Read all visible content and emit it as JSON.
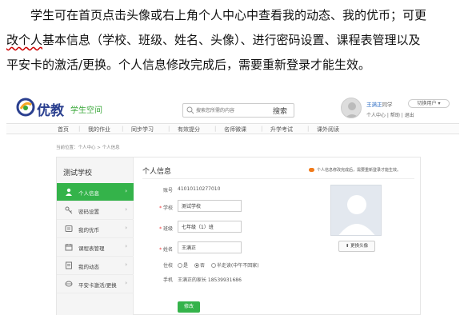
{
  "intro": {
    "line1": "学生可在首页点击头像或右上角个人中心中查看我的动态、我的优币；可更",
    "line2_start": "改个人",
    "line2_rest": "基本信息（学校、班级、姓名、头像）、进行密码设置、课程表管理以及",
    "line3": "平安卡的激活/更换。个人信息修改完成后，需要重新登录才能生效。"
  },
  "header": {
    "logo_text": "优教",
    "logo_sub": "学生空间",
    "search_placeholder": "搜索您所需的内容",
    "search_button": "搜索",
    "user_name": "王满正",
    "user_role": "同学",
    "switch_label": "切换用户",
    "links": "个人中心 | 帮助 | 退出"
  },
  "nav": {
    "items": [
      "首页",
      "我的作业",
      "同步学习",
      "有效提分",
      "名师微课",
      "升学考试",
      "课外阅读"
    ]
  },
  "breadcrumb": "当前位置：个人中心 > 个人信息",
  "sidebar": {
    "school": "测试学校",
    "items": [
      {
        "label": "个人信息",
        "icon": "user-icon"
      },
      {
        "label": "密码设置",
        "icon": "key-icon"
      },
      {
        "label": "我的优币",
        "icon": "coin-icon"
      },
      {
        "label": "课程表管理",
        "icon": "calendar-icon"
      },
      {
        "label": "我的动态",
        "icon": "activity-icon"
      },
      {
        "label": "平安卡激活/更换",
        "icon": "card-icon"
      }
    ]
  },
  "form": {
    "title": "个人信息",
    "hint": "个人信息修改完成后，需要重新登录才能生效。",
    "account_label": "账号",
    "account_value": "41010110277010",
    "school_label": "学校",
    "school_value": "测试学校",
    "class_label": "班级",
    "class_value": "七年级（1）班",
    "name_label": "姓名",
    "name_value": "王满正",
    "boarding_label": "住校",
    "boarding_options": [
      "是",
      "否",
      "半走读(中午不回家)"
    ],
    "phone_label": "手机",
    "phone_value": "王满正的家长 18539931686",
    "change_photo": "更换头像",
    "submit": "修改"
  },
  "colors": {
    "accent_green": "#34b34a",
    "link_blue": "#2b6cc4",
    "hint_orange": "#f07a1a"
  }
}
